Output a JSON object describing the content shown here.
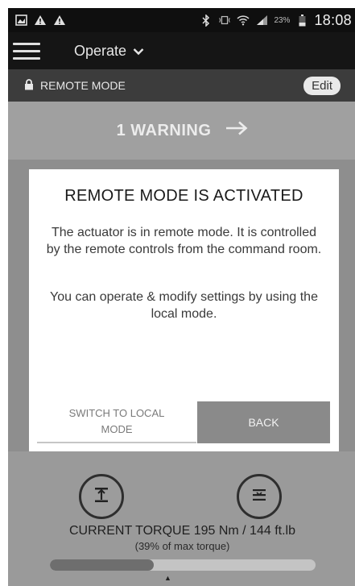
{
  "status_bar": {
    "battery_percent": "23%",
    "time": "18:08",
    "icons": [
      "image-icon",
      "warning-icon",
      "warning-icon",
      "bluetooth-icon",
      "vibrate-icon",
      "wifi-icon",
      "signal-icon",
      "battery-icon"
    ]
  },
  "header": {
    "menu_icon": "hamburger-icon",
    "mode_label": "Operate"
  },
  "remote_bar": {
    "label": "REMOTE MODE",
    "edit_label": "Edit"
  },
  "warning": {
    "label": "1 WARNING"
  },
  "dialog": {
    "title": "REMOTE MODE IS ACTIVATED",
    "body_1": "The actuator is in remote mode. It is controlled by the remote controls from the command room.",
    "body_2": "You can operate & modify settings by using the local mode.",
    "switch_label": "SWITCH TO LOCAL MODE",
    "back_label": "BACK"
  },
  "torque": {
    "label": "CURRENT TORQUE 195 Nm / 144 ft.lb",
    "sub_label": "(39% of max torque)",
    "fraction": 0.39
  },
  "colors": {
    "overlay_gray": "#8d8d8d",
    "header_dark": "#151515",
    "back_button": "#8a8a8a"
  }
}
